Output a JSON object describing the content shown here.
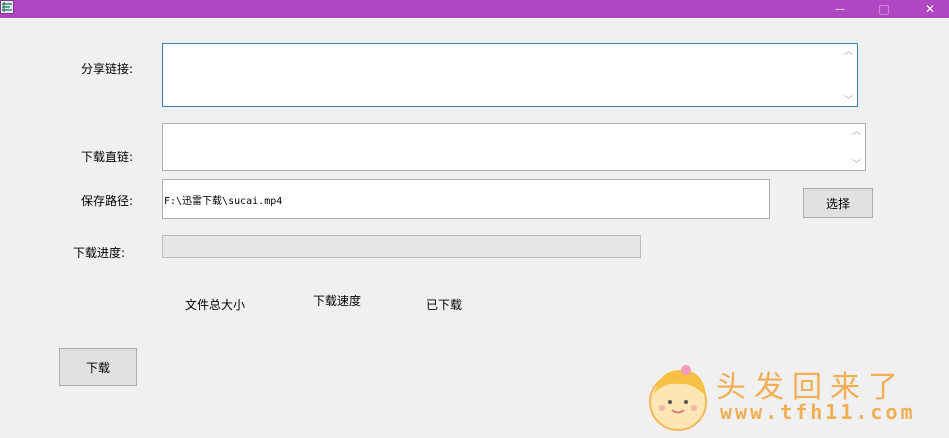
{
  "window": {
    "icon": "app-logo-icon",
    "controls": {
      "minimize": "—",
      "maximize": "□",
      "close": "✕"
    },
    "title_bar_color": "#b146c2"
  },
  "form": {
    "share_link": {
      "label": "分享链接:",
      "value": ""
    },
    "direct_link": {
      "label": "下载直链:",
      "value": ""
    },
    "save_path": {
      "label": "保存路径:",
      "value": "F:\\迅雷下载\\sucai.mp4",
      "browse_button": "选择"
    },
    "progress": {
      "label": "下载进度:",
      "value": 0
    }
  },
  "stats": {
    "total_size": "文件总大小",
    "speed": "下载速度",
    "downloaded": "已下载"
  },
  "actions": {
    "download_button": "下载"
  },
  "watermark": {
    "text": "头发回来了",
    "url": "www.tfh11.com"
  }
}
